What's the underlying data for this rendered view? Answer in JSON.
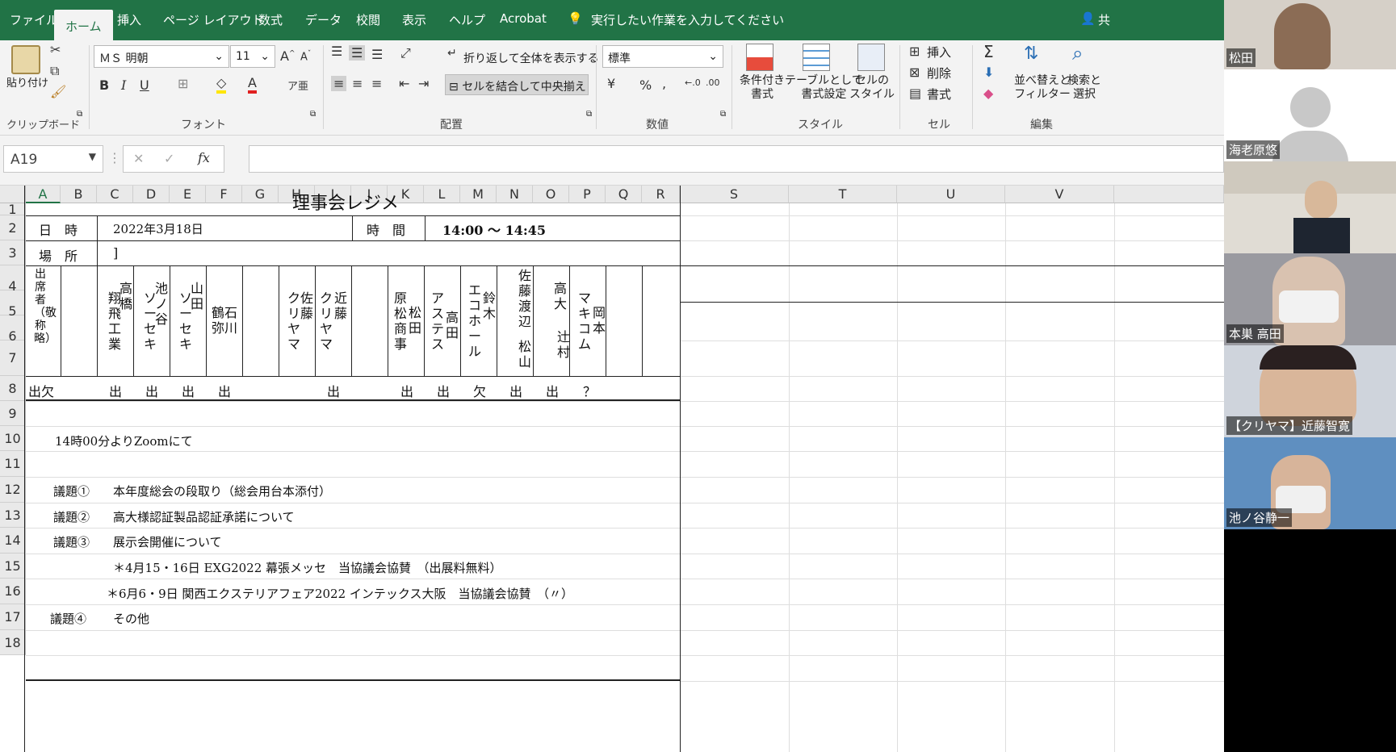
{
  "ribbon_tabs": [
    "ファイル",
    "ホーム",
    "挿入",
    "ページ レイアウト",
    "数式",
    "データ",
    "校閲",
    "表示",
    "ヘルプ",
    "Acrobat"
  ],
  "tell_me": "実行したい作業を入力してください",
  "share_label": "共",
  "ribbon": {
    "paste": "貼り付け",
    "clipboard_group": "クリップボード",
    "font_name": "ＭＳ 明朝",
    "font_size": "11",
    "font_group": "フォント",
    "wrap_text": "折り返して全体を表示する",
    "merge_center": "セルを結合して中央揃え",
    "alignment_group": "配置",
    "number_format": "標準",
    "number_group": "数値",
    "conditional_format": [
      "条件付き",
      "書式"
    ],
    "format_as_table": [
      "テーブルとして",
      "書式設定"
    ],
    "cell_styles": [
      "セルの",
      "スタイル"
    ],
    "styles_group": "スタイル",
    "insert": "挿入",
    "delete": "削除",
    "format": "書式",
    "cells_group": "セル",
    "sort_filter": [
      "並べ替えと",
      "フィルター"
    ],
    "find_select": [
      "検索と",
      "選択"
    ],
    "editing_group": "編集"
  },
  "name_box": "A19",
  "columns": [
    "A",
    "B",
    "C",
    "D",
    "E",
    "F",
    "G",
    "H",
    "I",
    "J",
    "K",
    "L",
    "M",
    "N",
    "O",
    "P",
    "Q",
    "R",
    "S",
    "T",
    "U",
    "V"
  ],
  "rows": [
    "1",
    "2",
    "3",
    "4",
    "5",
    "6",
    "7",
    "8",
    "9",
    "10",
    "11",
    "12",
    "13",
    "14",
    "15",
    "16",
    "17",
    "18"
  ],
  "sheet": {
    "title": "理事会レジメ",
    "date_label": "日　時",
    "date_value": "2022年3月18日",
    "time_label": "時　間",
    "time_value": "14:00 ～ 14:45",
    "place_label": "場　所",
    "place_value": "]",
    "attendee_header": "出席者（敬称略）",
    "attendees": [
      "翔飛工業",
      "高橋",
      "ソーセキ",
      "池ノ谷",
      "ソーセキ",
      "山田",
      "鶴弥",
      "石川",
      "クリヤマ",
      "佐藤",
      "クリヤマ",
      "近藤",
      "原松商事",
      "松田",
      "アステス",
      "高田",
      "エコホール",
      "鈴木",
      "佐藤渡辺",
      "松山",
      "高大",
      "辻村",
      "マキコム",
      "岡本"
    ],
    "attendance_label": "出欠",
    "attendance": [
      "出",
      "出",
      "出",
      "出",
      "出",
      "出",
      "出",
      "欠",
      "出",
      "出",
      "？"
    ],
    "line9": "14時00分よりZoomにて",
    "agenda": [
      {
        "label": "議題①",
        "text": "本年度総会の段取り（総会用台本添付）"
      },
      {
        "label": "議題②",
        "text": "高大様認証製品認証承諾について"
      },
      {
        "label": "議題③",
        "text": "展示会開催について"
      }
    ],
    "note1": "＊4月15・16日 EXG2022 幕張メッセ　当協議会協賛　（出展料無料）",
    "note2": "＊6月6・9日 関西エクステリアフェア2022 インテックス大阪　当協議会協賛　（〃）",
    "agenda4_label": "議題④",
    "agenda4_text": "その他"
  },
  "participants": [
    "松田",
    "海老原悠",
    "",
    "本巣 高田",
    "【クリヤマ】近藤智寛",
    "池ノ谷静一"
  ]
}
